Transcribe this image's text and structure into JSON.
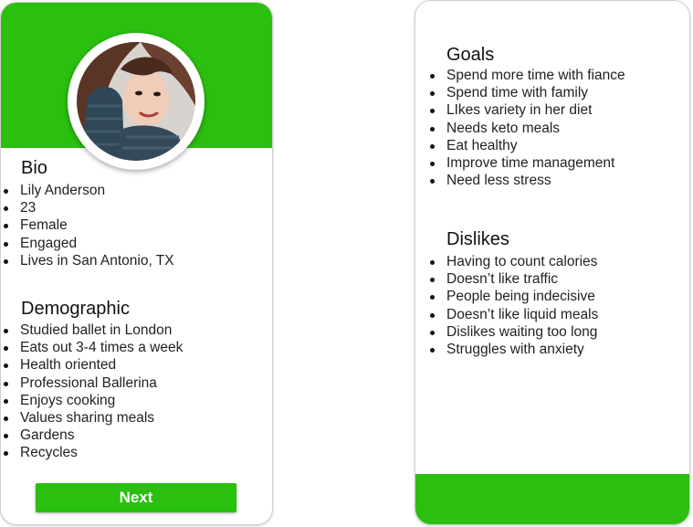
{
  "colors": {
    "accent": "#2bbf0f",
    "card_border": "#cfcfcf",
    "text": "#222222"
  },
  "profile_card": {
    "avatar_icon": "user-photo",
    "bio": {
      "title": "Bio",
      "items": [
        "Lily Anderson",
        "23",
        "Female",
        "Engaged",
        "Lives in San Antonio, TX"
      ]
    },
    "demographic": {
      "title": "Demographic",
      "items": [
        "Studied ballet in London",
        "Eats out 3-4 times a week",
        "Health oriented",
        "Professional Ballerina",
        "Enjoys cooking",
        "Values sharing meals",
        "Gardens",
        "Recycles"
      ]
    },
    "next_label": "Next"
  },
  "details_card": {
    "goals": {
      "title": "Goals",
      "items": [
        "Spend more time with fiance",
        "Spend time with family",
        "LIkes variety in her diet",
        "Needs keto meals",
        "Eat healthy",
        "Improve time management",
        "Need less stress"
      ]
    },
    "dislikes": {
      "title": "Dislikes",
      "items": [
        "Having to count calories",
        "Doesn’t like traffic",
        "People being indecisive",
        "Doesn’t like liquid meals",
        "Dislikes  waiting too long",
        "Struggles with anxiety"
      ]
    }
  }
}
